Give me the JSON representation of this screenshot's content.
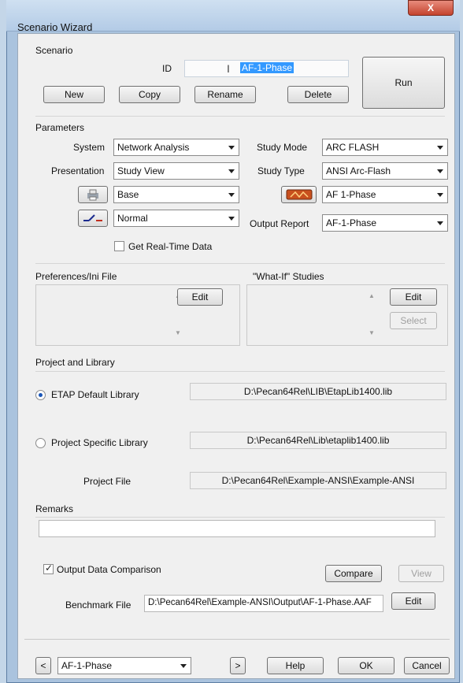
{
  "window": {
    "title": "Scenario Wizard",
    "close_label": "X"
  },
  "scenario": {
    "section_label": "Scenario",
    "id_label": "ID",
    "id_value": "AF-1-Phase",
    "buttons": {
      "new": "New",
      "copy": "Copy",
      "rename": "Rename",
      "delete": "Delete",
      "run": "Run"
    }
  },
  "parameters": {
    "section_label": "Parameters",
    "system_label": "System",
    "system_value": "Network Analysis",
    "presentation_label": "Presentation",
    "presentation_value": "Study View",
    "config_value": "Base",
    "revision_value": "Normal",
    "study_mode_label": "Study Mode",
    "study_mode_value": "ARC FLASH",
    "study_type_label": "Study Type",
    "study_type_value": "ANSI Arc-Flash",
    "study_case_value": "AF 1-Phase",
    "output_report_label": "Output Report",
    "output_report_value": "AF-1-Phase",
    "realtime_label": "Get Real-Time Data",
    "realtime_checked": false
  },
  "preferences": {
    "section_label": "Preferences/Ini File",
    "edit_label": "Edit"
  },
  "whatif": {
    "section_label": "\"What-If\" Studies",
    "edit_label": "Edit",
    "select_label": "Select"
  },
  "library": {
    "section_label": "Project and Library",
    "etap_default_label": "ETAP Default Library",
    "etap_default_path": "D:\\Pecan64Rel\\LIB\\EtapLib1400.lib",
    "project_specific_label": "Project Specific Library",
    "project_specific_path": "D:\\Pecan64Rel\\Lib\\etaplib1400.lib",
    "project_file_label": "Project File",
    "project_file_path": "D:\\Pecan64Rel\\Example-ANSI\\Example-ANSI"
  },
  "remarks": {
    "section_label": "Remarks",
    "value": ""
  },
  "comparison": {
    "checkbox_label": "Output Data Comparison",
    "checked": true,
    "compare_label": "Compare",
    "view_label": "View",
    "benchmark_label": "Benchmark File",
    "benchmark_path": "D:\\Pecan64Rel\\Example-ANSI\\Output\\AF-1-Phase.AAF",
    "edit_label": "Edit"
  },
  "footer": {
    "prev_label": "<",
    "scenario_value": "AF-1-Phase",
    "next_label": ">",
    "help_label": "Help",
    "ok_label": "OK",
    "cancel_label": "Cancel"
  },
  "colors": {
    "id_highlight": "#3399ff",
    "arc_flash_icon": "#c8501e"
  }
}
